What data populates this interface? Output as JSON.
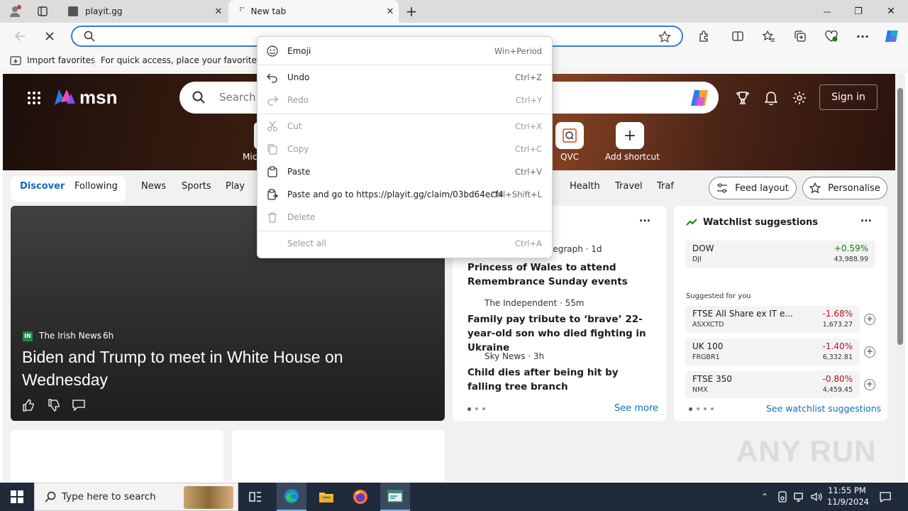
{
  "browser": {
    "tabs": [
      {
        "title": "playit.gg",
        "close": "✕"
      },
      {
        "title": "New tab",
        "close": "✕"
      }
    ],
    "new_tab": "+",
    "window_controls": {
      "minimize": "—",
      "maximize": "❐",
      "close": "✕"
    },
    "address": {
      "value": "",
      "placeholder": ""
    },
    "favorites_bar": {
      "import_label": "Import favorites",
      "hint": "For quick access, place your favorites here"
    }
  },
  "msn": {
    "logo": "msn",
    "search_placeholder": "Search t",
    "sign_in": "Sign in",
    "shortcuts": [
      {
        "label": "Mic"
      },
      {
        "label": "QVC"
      },
      {
        "label": "Add shortcut"
      }
    ],
    "nav": {
      "discover": "Discover",
      "following": "Following",
      "items": [
        "News",
        "Sports",
        "Play",
        "Health",
        "Travel",
        "Traf"
      ],
      "feed_layout": "Feed layout",
      "personalise": "Personalise"
    },
    "hero_story": {
      "source": "The Irish News",
      "age": "6h",
      "title": "Biden and Trump to meet in White House on Wednesday"
    },
    "news_card": {
      "more": "...",
      "items": [
        {
          "source": "legraph · 1d",
          "title": "Princess of Wales to attend Remembrance Sunday events"
        },
        {
          "source": "The Independent · 55m",
          "title": "Family pay tribute to ‘brave’ 22-year-old son who died fighting in Ukraine"
        },
        {
          "source": "Sky News · 3h",
          "title": "Child dies after being hit by falling tree branch"
        }
      ],
      "see_more": "See more"
    },
    "watchlist": {
      "title": "Watchlist suggestions",
      "more": "...",
      "top": {
        "name": "DOW",
        "ticker": "DJI",
        "change": "+0.59%",
        "price": "43,988.99"
      },
      "suggested_label": "Suggested for you",
      "suggested": [
        {
          "name": "FTSE All Share ex IT e...",
          "ticker": "ASXXCTD",
          "change": "-1.68%",
          "price": "1,673.27"
        },
        {
          "name": "UK 100",
          "ticker": "FRGBR1",
          "change": "-1.40%",
          "price": "6,332.81"
        },
        {
          "name": "FTSE 350",
          "ticker": "NMX",
          "change": "-0.80%",
          "price": "4,459.45"
        }
      ],
      "see_link": "See watchlist suggestions"
    }
  },
  "context_menu": {
    "items": [
      {
        "label": "Emoji",
        "shortcut": "Win+Period",
        "disabled": false
      },
      {
        "label": "Undo",
        "shortcut": "Ctrl+Z",
        "disabled": false
      },
      {
        "label": "Redo",
        "shortcut": "Ctrl+Y",
        "disabled": true
      },
      {
        "label": "Cut",
        "shortcut": "Ctrl+X",
        "disabled": true
      },
      {
        "label": "Copy",
        "shortcut": "Ctrl+C",
        "disabled": true
      },
      {
        "label": "Paste",
        "shortcut": "Ctrl+V",
        "disabled": false
      },
      {
        "label": "Paste and go to https://playit.gg/claim/03bd64ecf4",
        "shortcut": "Ctrl+Shift+L",
        "disabled": false
      },
      {
        "label": "Delete",
        "shortcut": "",
        "disabled": true
      },
      {
        "label": "Select all",
        "shortcut": "Ctrl+A",
        "disabled": true
      }
    ]
  },
  "taskbar": {
    "search_placeholder": "Type here to search",
    "time": "11:55 PM",
    "date": "11/9/2024"
  },
  "watermark": "ANY RUN",
  "colors": {
    "accent": "#0f6cbd",
    "positive": "#107c10",
    "negative": "#c50f1f",
    "taskbar": "#1f2b3a"
  }
}
